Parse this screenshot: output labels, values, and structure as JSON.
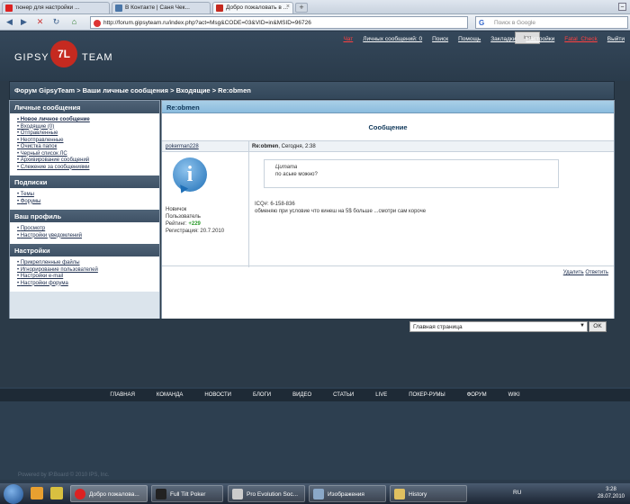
{
  "browser": {
    "tabs": [
      {
        "label": "тюнер для настройки ...",
        "icon": "opera-icon"
      },
      {
        "label": "В Контакте | Саня Чек...",
        "icon": "vk-icon"
      },
      {
        "label": "Добро пожаловать в ...",
        "icon": "forum-icon"
      }
    ],
    "url": "http://forum.gipsyteam.ru/index.php?act=Msg&CODE=03&VID=in&MSID=96726",
    "search_placeholder": "Поиск в Google"
  },
  "site": {
    "logo_left": "GIPSY",
    "logo_mark": "7L",
    "logo_right": "TEAM",
    "top_links": [
      "Чат",
      "Личных сообщений: 0",
      "Поиск",
      "Помощь",
      "Закладки",
      "Настройки",
      "Fatal_Check",
      "Выйти"
    ],
    "breadcrumb": "Форум GipsyTeam  >  Ваши личные сообщения  >  Входящие  >  Re:obmen"
  },
  "sidebar": {
    "sections": [
      {
        "title": "Личные сообщения",
        "items": [
          "Новое личное сообщение",
          "Входящие (0)",
          "Отправленные",
          "Неотправленные",
          "Очистка папок",
          "Черный список ЛС",
          "Архивирование сообщений",
          "Слежение за сообщениями"
        ]
      },
      {
        "title": "Подписки",
        "items": [
          "Темы",
          "Форумы"
        ]
      },
      {
        "title": "Ваш профиль",
        "items": [
          "Просмотр",
          "Настройки уведомлений"
        ]
      },
      {
        "title": "Настройки",
        "items": [
          "Прикрепленные файлы",
          "Игнорирование пользователей",
          "Настройки e-mail",
          "Настройки форума"
        ]
      }
    ]
  },
  "message": {
    "header": "Re:obmen",
    "title": "Сообщение",
    "author": "pokerman228",
    "subject": "Re:obmen",
    "date": ", Сегодня, 2:38",
    "user_status": "Новичок",
    "user_group": "Пользователь",
    "rating_label": "Рейтинг: ",
    "rating_value": "+229",
    "registration": "Регистрация: 20.7.2010",
    "quote_label": "Цитата",
    "quote_text": "по аське можно?",
    "body_line1": "ICQ#: 6-158-836",
    "body_line2": "обменяю при условие что кинеш на 5$ больше ...смотри сам короче",
    "actions": [
      "Удалить",
      "Ответить"
    ]
  },
  "jump": {
    "selected": "Главная страница",
    "ok_label": "OK"
  },
  "footer": {
    "nav": [
      "ГЛАВНАЯ",
      "КОМАНДА",
      "НОВОСТИ",
      "БЛОГИ",
      "ВИДЕО",
      "СТАТЬИ",
      "LIVE",
      "ПОКЕР-РУМЫ",
      "ФОРУМ",
      "WIKI"
    ],
    "copyright": "Powered by IP.Board © 2010  IPS, Inc."
  },
  "taskbar": {
    "buttons": [
      "Добро пожалова...",
      "Full Tilt Poker",
      "Pro Evolution Soc...",
      "Изображения",
      "History"
    ],
    "lang": "RU",
    "time": "3:28",
    "date": "28.07.2010"
  },
  "colors": {
    "accent_red": "#c52a20",
    "header_blue": "#8bbcde",
    "page_bg": "#2b3a48"
  }
}
